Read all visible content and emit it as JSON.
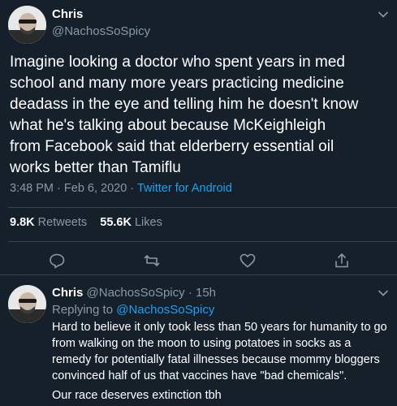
{
  "main_tweet": {
    "author_name": "Chris",
    "author_handle": "@NachosSoSpicy",
    "text": "Imagine looking a doctor who spent years in med school and many more years practicing medicine deadass in the eye and telling him he doesn't know what he's talking about because McKeighleigh from Facebook said that elderberry essential oil works better than Tamiflu",
    "time": "3:48 PM",
    "date": "Feb 6, 2020",
    "separator": "·",
    "source": "Twitter for Android",
    "retweets_count": "9.8K",
    "retweets_label": "Retweets",
    "likes_count": "55.6K",
    "likes_label": "Likes",
    "actions": [
      "reply-icon",
      "retweet-icon",
      "like-icon",
      "share-icon"
    ]
  },
  "reply_tweet": {
    "author_name": "Chris",
    "author_handle": "@NachosSoSpicy",
    "separator": "·",
    "age": "15h",
    "replying_label": "Replying to",
    "replying_to": "@NachosSoSpicy",
    "text": "Hard to believe it only took less than 50 years for humanity to go from walking on the moon to using potatoes in socks as a remedy for potentially fatal illnesses because mommy bloggers convinced half of us that vaccines have \"bad chemicals\".",
    "last_line": "Our race deserves extinction tbh"
  },
  "colors": {
    "background": "#15202b",
    "text": "#ffffff",
    "muted": "#8899a6",
    "accent": "#1da1f2",
    "divider": "#38444d"
  }
}
